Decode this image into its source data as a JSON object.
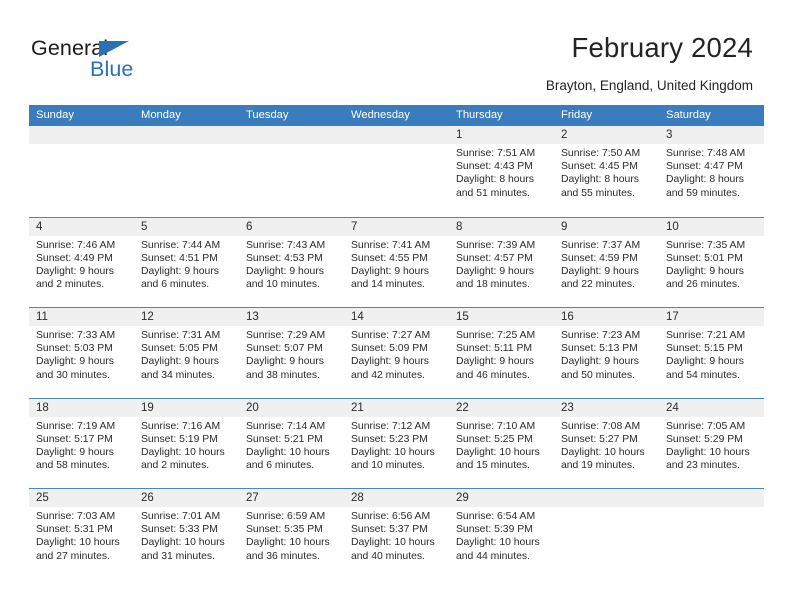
{
  "brand": {
    "name_part1": "General",
    "name_part2": "Blue",
    "accent_color": "#2a72b5"
  },
  "header": {
    "title": "February 2024",
    "location": "Brayton, England, United Kingdom",
    "header_bar_color": "#3a7cbd"
  },
  "weekdays": [
    "Sunday",
    "Monday",
    "Tuesday",
    "Wednesday",
    "Thursday",
    "Friday",
    "Saturday"
  ],
  "weeks": [
    [
      {
        "day": "",
        "sunrise": "",
        "sunset": "",
        "daylight_line1": "",
        "daylight_line2": ""
      },
      {
        "day": "",
        "sunrise": "",
        "sunset": "",
        "daylight_line1": "",
        "daylight_line2": ""
      },
      {
        "day": "",
        "sunrise": "",
        "sunset": "",
        "daylight_line1": "",
        "daylight_line2": ""
      },
      {
        "day": "",
        "sunrise": "",
        "sunset": "",
        "daylight_line1": "",
        "daylight_line2": ""
      },
      {
        "day": "1",
        "sunrise": "Sunrise: 7:51 AM",
        "sunset": "Sunset: 4:43 PM",
        "daylight_line1": "Daylight: 8 hours",
        "daylight_line2": "and 51 minutes."
      },
      {
        "day": "2",
        "sunrise": "Sunrise: 7:50 AM",
        "sunset": "Sunset: 4:45 PM",
        "daylight_line1": "Daylight: 8 hours",
        "daylight_line2": "and 55 minutes."
      },
      {
        "day": "3",
        "sunrise": "Sunrise: 7:48 AM",
        "sunset": "Sunset: 4:47 PM",
        "daylight_line1": "Daylight: 8 hours",
        "daylight_line2": "and 59 minutes."
      }
    ],
    [
      {
        "day": "4",
        "sunrise": "Sunrise: 7:46 AM",
        "sunset": "Sunset: 4:49 PM",
        "daylight_line1": "Daylight: 9 hours",
        "daylight_line2": "and 2 minutes."
      },
      {
        "day": "5",
        "sunrise": "Sunrise: 7:44 AM",
        "sunset": "Sunset: 4:51 PM",
        "daylight_line1": "Daylight: 9 hours",
        "daylight_line2": "and 6 minutes."
      },
      {
        "day": "6",
        "sunrise": "Sunrise: 7:43 AM",
        "sunset": "Sunset: 4:53 PM",
        "daylight_line1": "Daylight: 9 hours",
        "daylight_line2": "and 10 minutes."
      },
      {
        "day": "7",
        "sunrise": "Sunrise: 7:41 AM",
        "sunset": "Sunset: 4:55 PM",
        "daylight_line1": "Daylight: 9 hours",
        "daylight_line2": "and 14 minutes."
      },
      {
        "day": "8",
        "sunrise": "Sunrise: 7:39 AM",
        "sunset": "Sunset: 4:57 PM",
        "daylight_line1": "Daylight: 9 hours",
        "daylight_line2": "and 18 minutes."
      },
      {
        "day": "9",
        "sunrise": "Sunrise: 7:37 AM",
        "sunset": "Sunset: 4:59 PM",
        "daylight_line1": "Daylight: 9 hours",
        "daylight_line2": "and 22 minutes."
      },
      {
        "day": "10",
        "sunrise": "Sunrise: 7:35 AM",
        "sunset": "Sunset: 5:01 PM",
        "daylight_line1": "Daylight: 9 hours",
        "daylight_line2": "and 26 minutes."
      }
    ],
    [
      {
        "day": "11",
        "sunrise": "Sunrise: 7:33 AM",
        "sunset": "Sunset: 5:03 PM",
        "daylight_line1": "Daylight: 9 hours",
        "daylight_line2": "and 30 minutes."
      },
      {
        "day": "12",
        "sunrise": "Sunrise: 7:31 AM",
        "sunset": "Sunset: 5:05 PM",
        "daylight_line1": "Daylight: 9 hours",
        "daylight_line2": "and 34 minutes."
      },
      {
        "day": "13",
        "sunrise": "Sunrise: 7:29 AM",
        "sunset": "Sunset: 5:07 PM",
        "daylight_line1": "Daylight: 9 hours",
        "daylight_line2": "and 38 minutes."
      },
      {
        "day": "14",
        "sunrise": "Sunrise: 7:27 AM",
        "sunset": "Sunset: 5:09 PM",
        "daylight_line1": "Daylight: 9 hours",
        "daylight_line2": "and 42 minutes."
      },
      {
        "day": "15",
        "sunrise": "Sunrise: 7:25 AM",
        "sunset": "Sunset: 5:11 PM",
        "daylight_line1": "Daylight: 9 hours",
        "daylight_line2": "and 46 minutes."
      },
      {
        "day": "16",
        "sunrise": "Sunrise: 7:23 AM",
        "sunset": "Sunset: 5:13 PM",
        "daylight_line1": "Daylight: 9 hours",
        "daylight_line2": "and 50 minutes."
      },
      {
        "day": "17",
        "sunrise": "Sunrise: 7:21 AM",
        "sunset": "Sunset: 5:15 PM",
        "daylight_line1": "Daylight: 9 hours",
        "daylight_line2": "and 54 minutes."
      }
    ],
    [
      {
        "day": "18",
        "sunrise": "Sunrise: 7:19 AM",
        "sunset": "Sunset: 5:17 PM",
        "daylight_line1": "Daylight: 9 hours",
        "daylight_line2": "and 58 minutes."
      },
      {
        "day": "19",
        "sunrise": "Sunrise: 7:16 AM",
        "sunset": "Sunset: 5:19 PM",
        "daylight_line1": "Daylight: 10 hours",
        "daylight_line2": "and 2 minutes."
      },
      {
        "day": "20",
        "sunrise": "Sunrise: 7:14 AM",
        "sunset": "Sunset: 5:21 PM",
        "daylight_line1": "Daylight: 10 hours",
        "daylight_line2": "and 6 minutes."
      },
      {
        "day": "21",
        "sunrise": "Sunrise: 7:12 AM",
        "sunset": "Sunset: 5:23 PM",
        "daylight_line1": "Daylight: 10 hours",
        "daylight_line2": "and 10 minutes."
      },
      {
        "day": "22",
        "sunrise": "Sunrise: 7:10 AM",
        "sunset": "Sunset: 5:25 PM",
        "daylight_line1": "Daylight: 10 hours",
        "daylight_line2": "and 15 minutes."
      },
      {
        "day": "23",
        "sunrise": "Sunrise: 7:08 AM",
        "sunset": "Sunset: 5:27 PM",
        "daylight_line1": "Daylight: 10 hours",
        "daylight_line2": "and 19 minutes."
      },
      {
        "day": "24",
        "sunrise": "Sunrise: 7:05 AM",
        "sunset": "Sunset: 5:29 PM",
        "daylight_line1": "Daylight: 10 hours",
        "daylight_line2": "and 23 minutes."
      }
    ],
    [
      {
        "day": "25",
        "sunrise": "Sunrise: 7:03 AM",
        "sunset": "Sunset: 5:31 PM",
        "daylight_line1": "Daylight: 10 hours",
        "daylight_line2": "and 27 minutes."
      },
      {
        "day": "26",
        "sunrise": "Sunrise: 7:01 AM",
        "sunset": "Sunset: 5:33 PM",
        "daylight_line1": "Daylight: 10 hours",
        "daylight_line2": "and 31 minutes."
      },
      {
        "day": "27",
        "sunrise": "Sunrise: 6:59 AM",
        "sunset": "Sunset: 5:35 PM",
        "daylight_line1": "Daylight: 10 hours",
        "daylight_line2": "and 36 minutes."
      },
      {
        "day": "28",
        "sunrise": "Sunrise: 6:56 AM",
        "sunset": "Sunset: 5:37 PM",
        "daylight_line1": "Daylight: 10 hours",
        "daylight_line2": "and 40 minutes."
      },
      {
        "day": "29",
        "sunrise": "Sunrise: 6:54 AM",
        "sunset": "Sunset: 5:39 PM",
        "daylight_line1": "Daylight: 10 hours",
        "daylight_line2": "and 44 minutes."
      },
      {
        "day": "",
        "sunrise": "",
        "sunset": "",
        "daylight_line1": "",
        "daylight_line2": ""
      },
      {
        "day": "",
        "sunrise": "",
        "sunset": "",
        "daylight_line1": "",
        "daylight_line2": ""
      }
    ]
  ]
}
